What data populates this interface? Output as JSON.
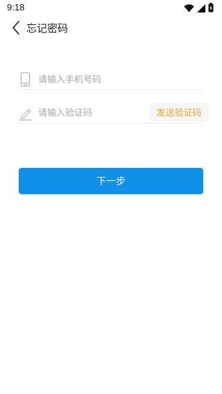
{
  "status_bar": {
    "time": "9:18",
    "icons": [
      "wifi-icon",
      "cellular-signal-icon",
      "battery-icon"
    ]
  },
  "header": {
    "back_icon": "chevron-left-icon",
    "title": "忘记密码"
  },
  "form": {
    "phone": {
      "icon": "phone-icon",
      "value": "",
      "placeholder": "请输入手机号码"
    },
    "code": {
      "icon": "pencil-icon",
      "value": "",
      "placeholder": "请输入验证码",
      "send_label": "发送验证码"
    }
  },
  "actions": {
    "next_label": "下一步"
  },
  "colors": {
    "primary": "#1190ea",
    "send_code_text": "#f0a52b",
    "placeholder": "#a8a8a8",
    "divider": "#eeeeee"
  }
}
